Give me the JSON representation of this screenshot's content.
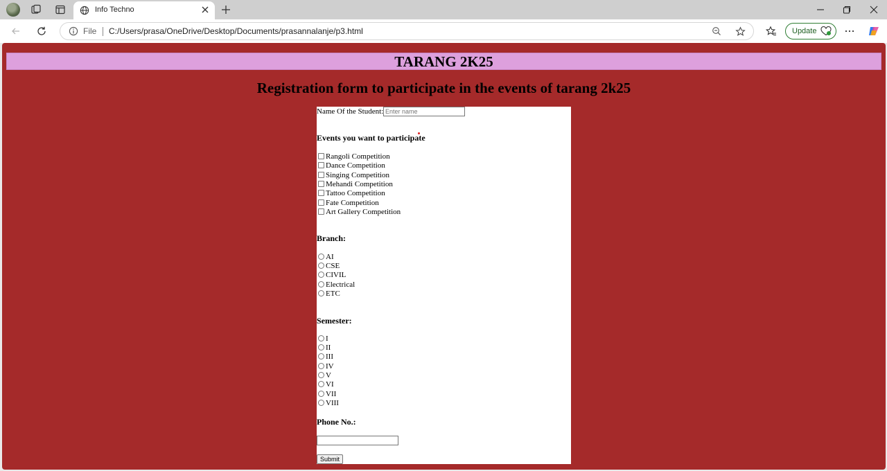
{
  "browser": {
    "tab_title": "Info Techno",
    "address_prefix": "File",
    "url": "C:/Users/prasa/OneDrive/Desktop/Documents/prasannalanje/p3.html",
    "update_label": "Update"
  },
  "page": {
    "banner_title": "TARANG 2K25",
    "subtitle": "Registration form to participate in the events of tarang 2k25",
    "name_label": "Name Of the Student:",
    "name_placeholder": "Enter name",
    "events_heading": "Events you want to participate",
    "events": [
      "Rangoli Competition",
      "Dance Competition",
      "Singing Competition",
      "Mehandi Competition",
      "Tattoo Competition",
      "Fate Competition",
      "Art Gallery Competition"
    ],
    "branch_heading": "Branch:",
    "branches": [
      "AI",
      "CSE",
      "CIVIL",
      "Electrical",
      "ETC"
    ],
    "semester_heading": "Semester:",
    "semesters": [
      "I",
      "II",
      "III",
      "IV",
      "V",
      "VI",
      "VII",
      "VIII"
    ],
    "phone_heading": "Phone No.:",
    "submit_label": "Submit"
  },
  "colors": {
    "page_background": "#a52a2a",
    "banner_background": "#dda0dd",
    "form_background": "#ffffff"
  }
}
